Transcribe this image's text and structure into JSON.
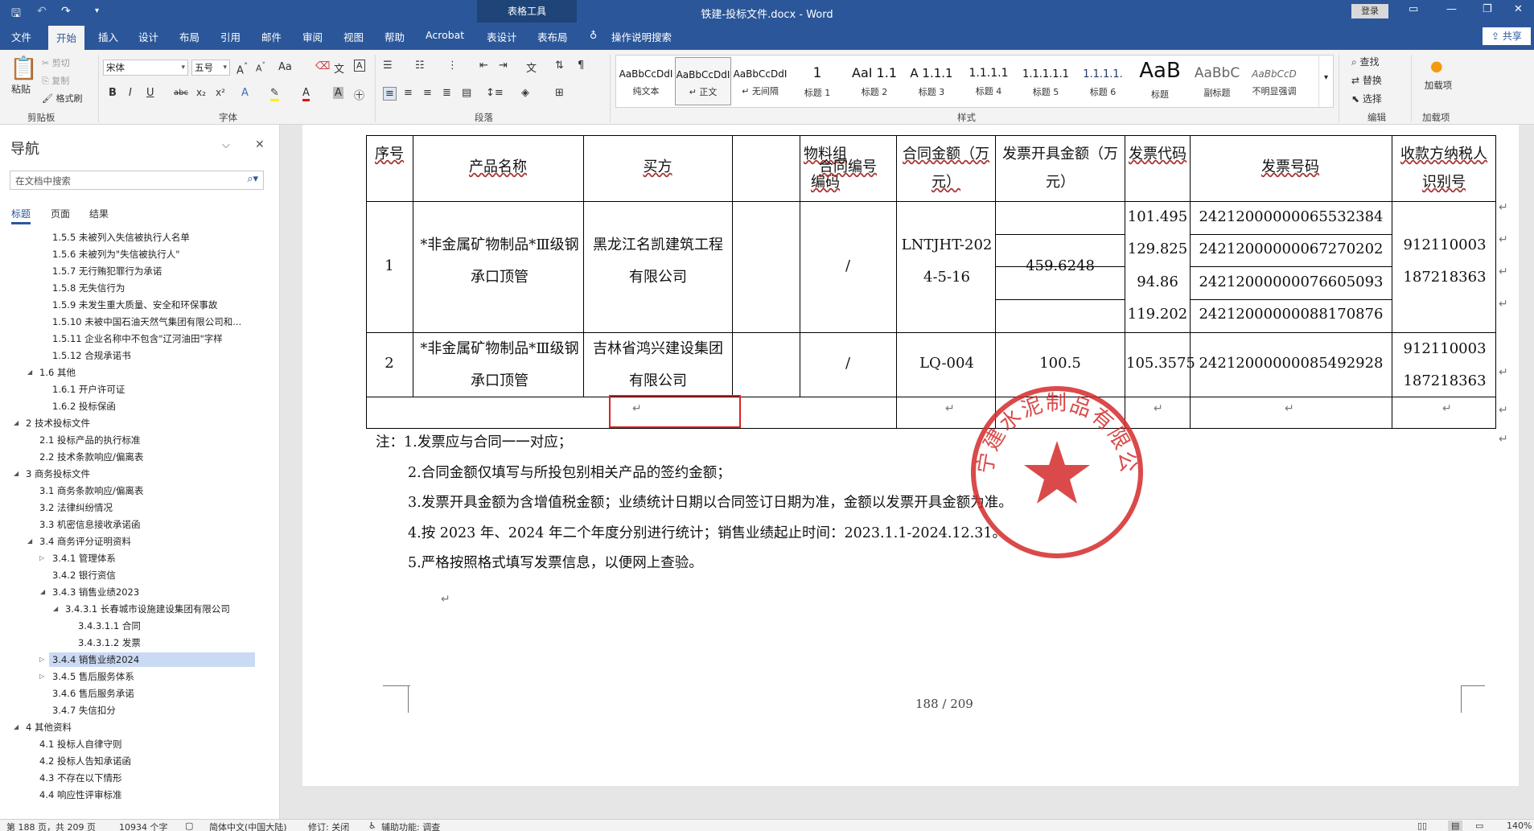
{
  "titlebar": {
    "doc_title": "铁建-投标文件.docx  -  Word",
    "context_tab": "表格工具",
    "signin": "登录"
  },
  "tabs": [
    "文件",
    "开始",
    "插入",
    "设计",
    "布局",
    "引用",
    "邮件",
    "审阅",
    "视图",
    "帮助",
    "Acrobat",
    "表设计",
    "表布局"
  ],
  "tell_me": "操作说明搜索",
  "share": "共享",
  "ribbon": {
    "clipboard": {
      "paste": "粘贴",
      "cut": "剪切",
      "copy": "复制",
      "format_painter": "格式刷",
      "label": "剪贴板"
    },
    "font": {
      "name": "宋体",
      "size": "五号",
      "label": "字体"
    },
    "paragraph": {
      "label": "段落"
    },
    "styles": {
      "label": "样式",
      "items": [
        {
          "preview": "AaBbCcDdI",
          "name": "纯文本"
        },
        {
          "preview": "AaBbCcDdI",
          "name": "↵ 正文"
        },
        {
          "preview": "AaBbCcDdI",
          "name": "↵ 无间隔"
        },
        {
          "preview": "1",
          "name": "标题 1"
        },
        {
          "preview": "AaI 1.1",
          "name": "标题 2"
        },
        {
          "preview": "A 1.1.1",
          "name": "标题 3"
        },
        {
          "preview": "1.1.1.1",
          "name": "标题 4"
        },
        {
          "preview": "1.1.1.1.1",
          "name": "标题 5"
        },
        {
          "preview": "1.1.1.1.",
          "name": "标题 6"
        },
        {
          "preview": "AaB",
          "name": "标题"
        },
        {
          "preview": "AaBbC",
          "name": "副标题"
        },
        {
          "preview": "AaBbCcD",
          "name": "不明显强调"
        }
      ]
    },
    "editing": {
      "find": "查找",
      "replace": "替换",
      "select": "选择",
      "label": "编辑"
    },
    "addins": {
      "btn": "加载项",
      "label": "加载项"
    }
  },
  "nav": {
    "title": "导航",
    "search_placeholder": "在文档中搜索",
    "tabs": [
      "标题",
      "页面",
      "结果"
    ],
    "items": [
      "1.5.5 未被列入失信被执行人名单",
      "1.5.6 未被列为\"失信被执行人\"",
      "1.5.7 无行贿犯罪行为承诺",
      "1.5.8 无失信行为",
      "1.5.9 未发生重大质量、安全和环保事故",
      "1.5.10 未被中国石油天然气集团有限公司和...",
      "1.5.11 企业名称中不包含\"辽河油田\"字样",
      "1.5.12 合规承诺书",
      "1.6 其他",
      "1.6.1 开户许可证",
      "1.6.2 投标保函",
      "2 技术投标文件",
      "2.1 投标产品的执行标准",
      "2.2 技术条款响应/偏离表",
      "3 商务投标文件",
      "3.1 商务条款响应/偏离表",
      "3.2 法律纠纷情况",
      "3.3 机密信息接收承诺函",
      "3.4 商务评分证明资料",
      "3.4.1 管理体系",
      "3.4.2 银行资信",
      "3.4.3 销售业绩2023",
      "3.4.3.1 长春城市设施建设集团有限公司",
      "3.4.3.1.1 合同",
      "3.4.3.1.2 发票",
      "3.4.4 销售业绩2024",
      "3.4.5 售后服务体系",
      "3.4.6 售后服务承诺",
      "3.4.7 失信扣分",
      "4 其他资料",
      "4.1 投标人自律守则",
      "4.2 投标人告知承诺函",
      "4.3 不存在以下情形",
      "4.4 响应性评审标准"
    ]
  },
  "table": {
    "headers": [
      "序号",
      "产品名称",
      "买方",
      "物料组编码",
      "合同编号",
      "合同金额（万元）",
      "发票开具金额（万元）",
      "发票代码",
      "发票号码",
      "收款方纳税人识别号"
    ],
    "rows": [
      {
        "no": "1",
        "product": "*非金属矿物制品*Ⅲ级钢承口顶管",
        "buyer": "黑龙江名凯建筑工程有限公司",
        "material": "/",
        "contract": "LNTJHT-2024-5-16",
        "amount": "459.6248",
        "invoice_amounts": [
          "101.495",
          "129.825",
          "94.86",
          "119.202"
        ],
        "invoice_code": "",
        "invoice_nos": [
          "24212000000065532384",
          "24212000000067270202",
          "24212000000076605093",
          "24212000000088170876"
        ],
        "taxid": "912110003187218363"
      },
      {
        "no": "2",
        "product": "*非金属矿物制品*Ⅲ级钢承口顶管",
        "buyer": "吉林省鸿兴建设集团有限公司",
        "material": "/",
        "contract": "LQ-004",
        "amount": "100.5",
        "invoice_amounts": [
          "105.3575"
        ],
        "invoice_code": "",
        "invoice_nos": [
          "24212000000085492928"
        ],
        "taxid": "912110003187218363"
      }
    ]
  },
  "notes": [
    "注：1.发票应与合同一一对应；",
    "2.合同金额仅填写与所投包别相关产品的签约金额；",
    "3.发票开具金额为含增值税金额；业绩统计日期以合同签订日期为准，金额以发票开具金额为准。",
    "4.按 2023 年、2024 年二个年度分别进行统计；销售业绩起止时间：2023.1.1-2024.12.31。",
    "5.严格按照格式填写发票信息，以便网上查验。"
  ],
  "stamp": {
    "text": "辽宁建水泥制品有限公司"
  },
  "page_number": "188 / 209",
  "status": {
    "page": "第 188 页，共 209 页",
    "words": "10934 个字",
    "language": "简体中文(中国大陆)",
    "track": "修订: 关闭",
    "accessibility": "辅助功能: 调查",
    "zoom": "140%"
  },
  "colors": {
    "brand": "#2b579a",
    "stamp": "#d42a2a",
    "highlight": "#c9daf4"
  }
}
